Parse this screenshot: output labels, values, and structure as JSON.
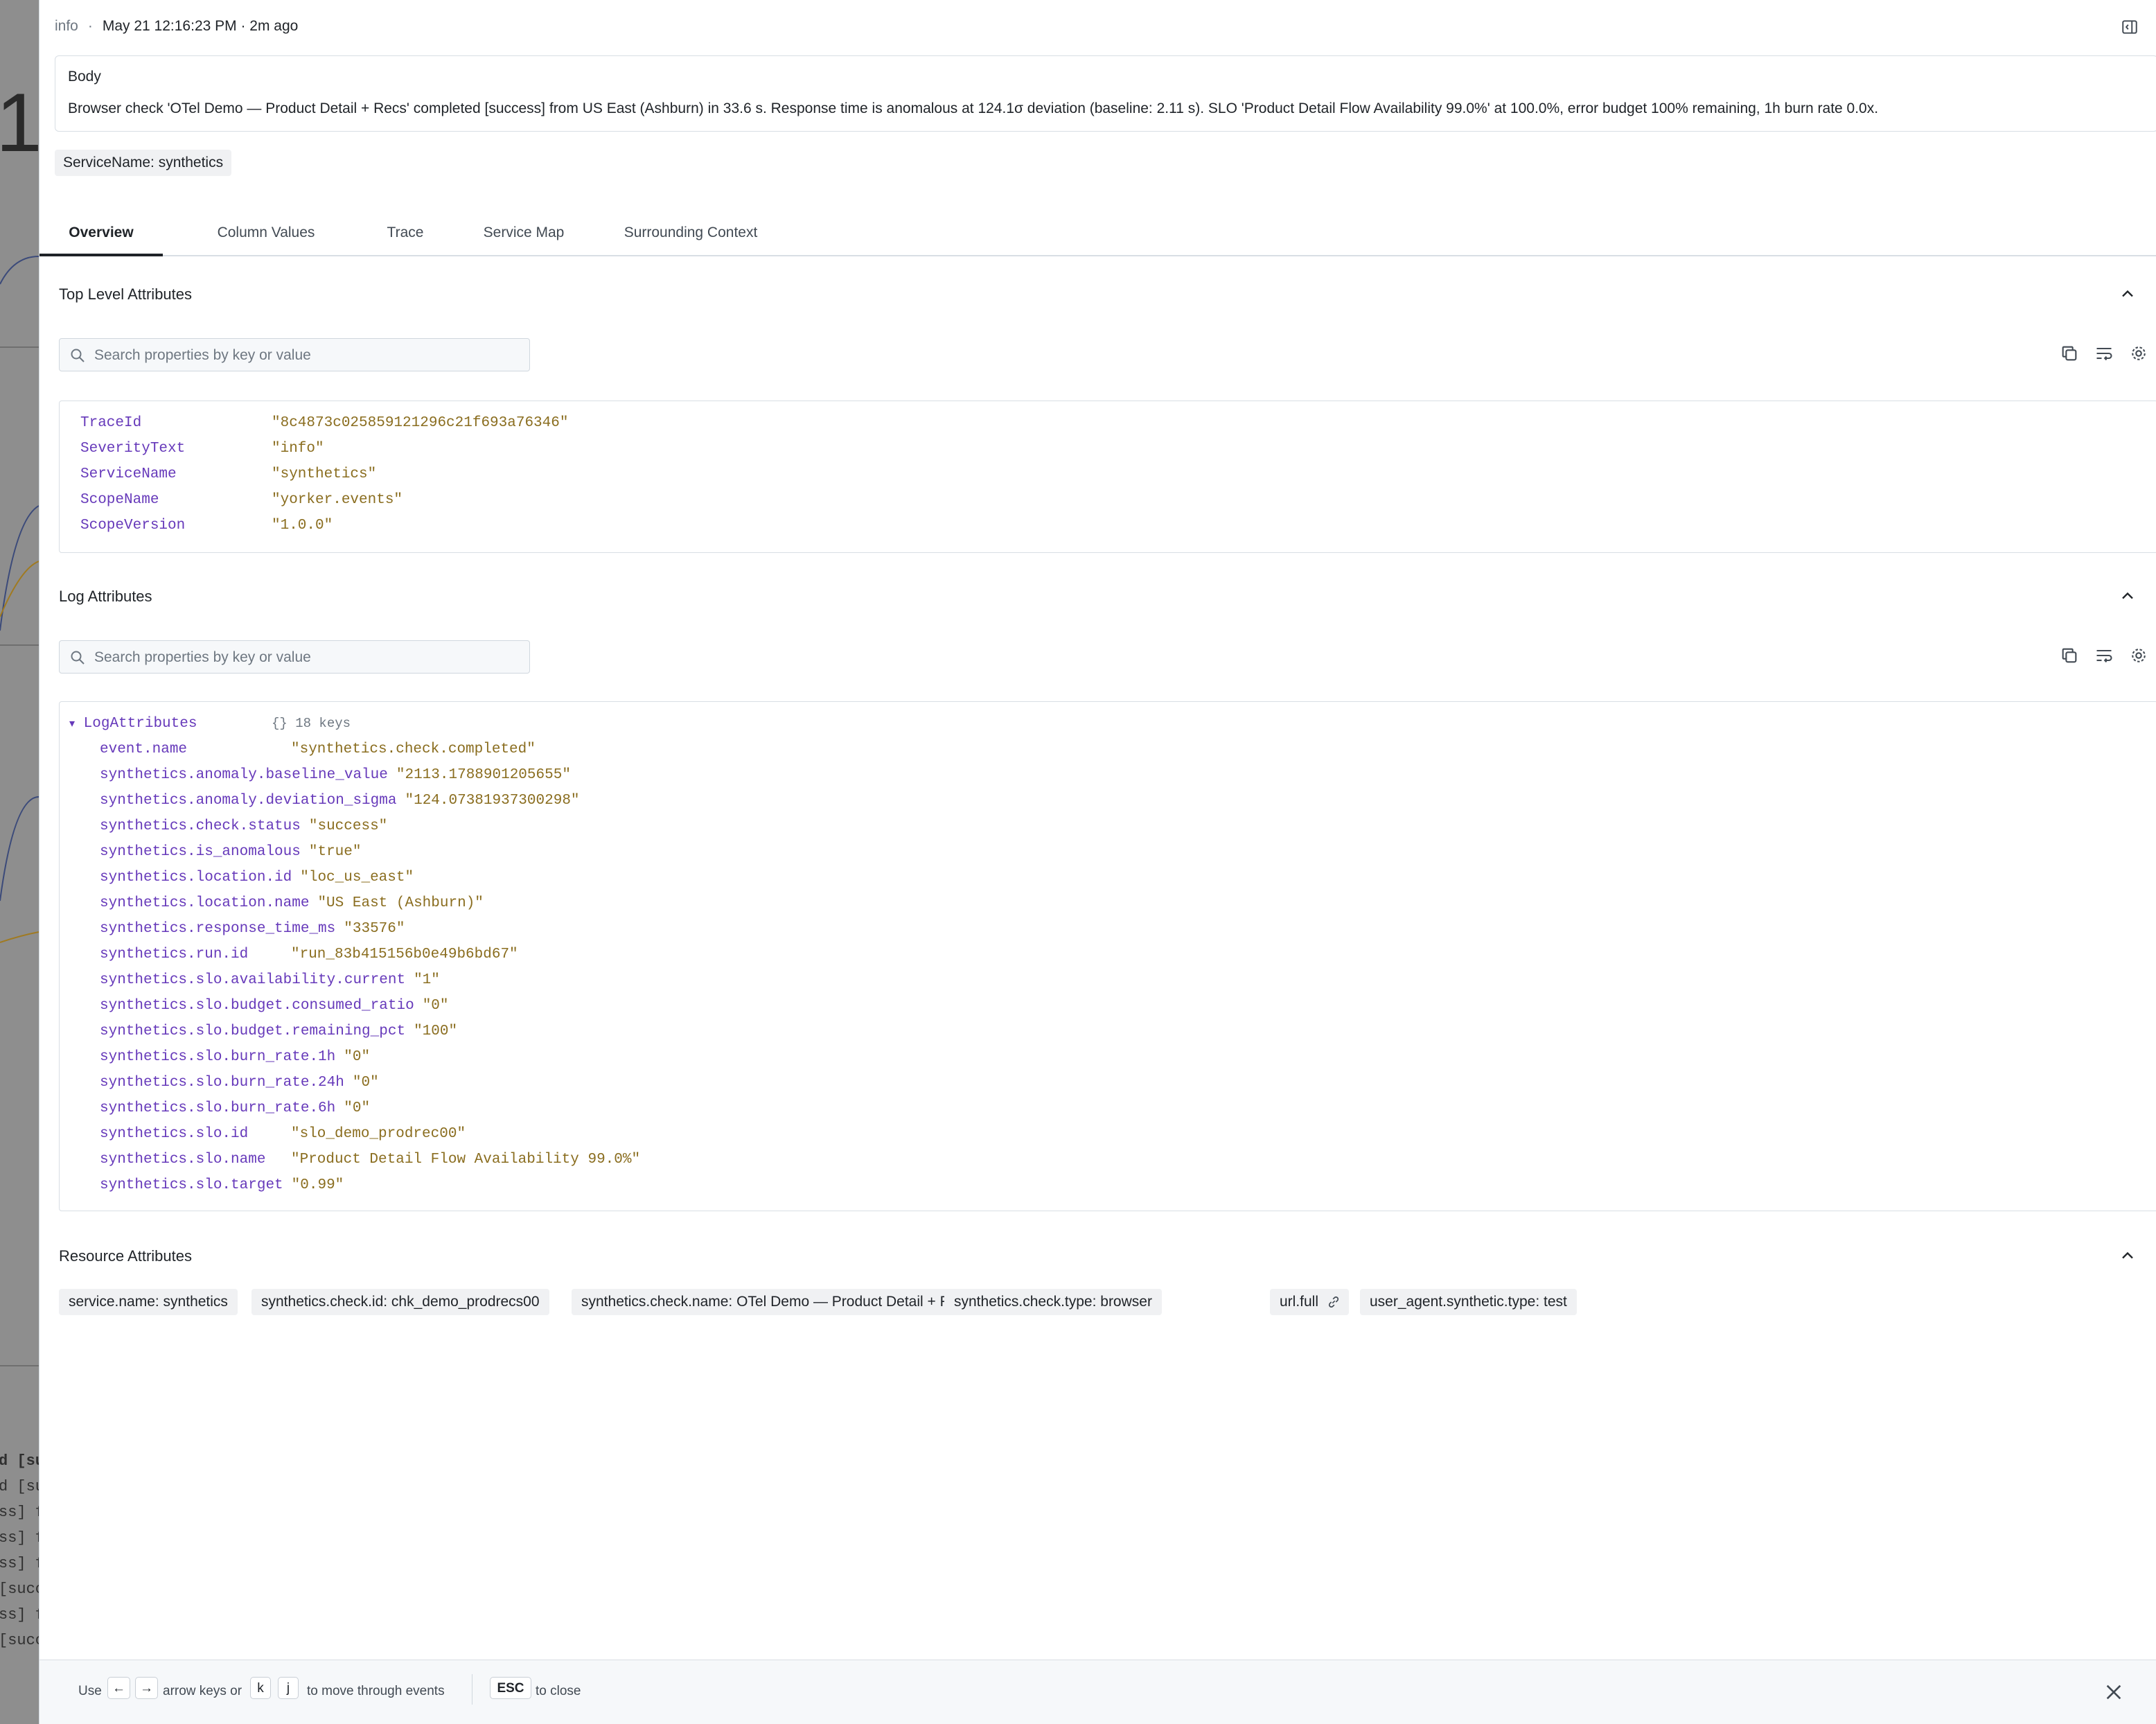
{
  "background": {
    "big_char": "1",
    "log_rows": [
      "d [su",
      "d [su",
      "ss] f",
      "ss] f",
      "ss] f",
      "[succ",
      "ss] f",
      "[succ"
    ]
  },
  "header": {
    "severity": "info",
    "separator": "·",
    "timestamp": "May 21 12:16:23 PM · 2m ago"
  },
  "body": {
    "label": "Body",
    "text": "Browser check 'OTel Demo — Product Detail + Recs' completed [success] from US East (Ashburn) in 33.6 s. Response time is anomalous at 124.1σ deviation (baseline: 2.11 s). SLO 'Product Detail Flow Availability 99.0%' at 100.0%, error budget 100% remaining, 1h burn rate 0.0x."
  },
  "service_chip": "ServiceName: synthetics",
  "tabs": [
    "Overview",
    "Column Values",
    "Trace",
    "Service Map",
    "Surrounding Context"
  ],
  "top_level": {
    "title": "Top Level Attributes",
    "search_placeholder": "Search properties by key or value",
    "rows": [
      {
        "key": "TraceId",
        "value": "\"8c4873c025859121296c21f693a76346\""
      },
      {
        "key": "SeverityText",
        "value": "\"info\""
      },
      {
        "key": "ServiceName",
        "value": "\"synthetics\""
      },
      {
        "key": "ScopeName",
        "value": "\"yorker.events\""
      },
      {
        "key": "ScopeVersion",
        "value": "\"1.0.0\""
      }
    ]
  },
  "log_attrs": {
    "title": "Log Attributes",
    "search_placeholder": "Search properties by key or value",
    "root_key": "LogAttributes",
    "root_meta": "{} 18 keys",
    "rows": [
      {
        "key": "event.name",
        "value": "\"synthetics.check.completed\""
      },
      {
        "key": "synthetics.anomaly.baseline_value",
        "value": "\"2113.1788901205655\""
      },
      {
        "key": "synthetics.anomaly.deviation_sigma",
        "value": "\"124.07381937300298\""
      },
      {
        "key": "synthetics.check.status",
        "value": "\"success\""
      },
      {
        "key": "synthetics.is_anomalous",
        "value": "\"true\""
      },
      {
        "key": "synthetics.location.id",
        "value": "\"loc_us_east\""
      },
      {
        "key": "synthetics.location.name",
        "value": "\"US East (Ashburn)\""
      },
      {
        "key": "synthetics.response_time_ms",
        "value": "\"33576\""
      },
      {
        "key": "synthetics.run.id",
        "value": "\"run_83b415156b0e49b6bd67\""
      },
      {
        "key": "synthetics.slo.availability.current",
        "value": "\"1\""
      },
      {
        "key": "synthetics.slo.budget.consumed_ratio",
        "value": "\"0\""
      },
      {
        "key": "synthetics.slo.budget.remaining_pct",
        "value": "\"100\""
      },
      {
        "key": "synthetics.slo.burn_rate.1h",
        "value": "\"0\""
      },
      {
        "key": "synthetics.slo.burn_rate.24h",
        "value": "\"0\""
      },
      {
        "key": "synthetics.slo.burn_rate.6h",
        "value": "\"0\""
      },
      {
        "key": "synthetics.slo.id",
        "value": "\"slo_demo_prodrec00\""
      },
      {
        "key": "synthetics.slo.name",
        "value": "\"Product Detail Flow Availability 99.0%\""
      },
      {
        "key": "synthetics.slo.target",
        "value": "\"0.99\""
      }
    ]
  },
  "resource": {
    "title": "Resource Attributes",
    "chips": [
      "service.name: synthetics",
      "synthetics.check.id: chk_demo_prodrecs00",
      "synthetics.check.name: OTel Demo — Product Detail + Recs",
      "synthetics.check.type: browser",
      "url.full",
      "user_agent.synthetic.type: test"
    ]
  },
  "footer": {
    "use": "Use",
    "left_key": "←",
    "right_key": "→",
    "arrow_text": "arrow keys or",
    "k_key": "k",
    "j_key": "j",
    "move_text": "to move through events",
    "esc_key": "ESC",
    "close_text": "to close"
  }
}
